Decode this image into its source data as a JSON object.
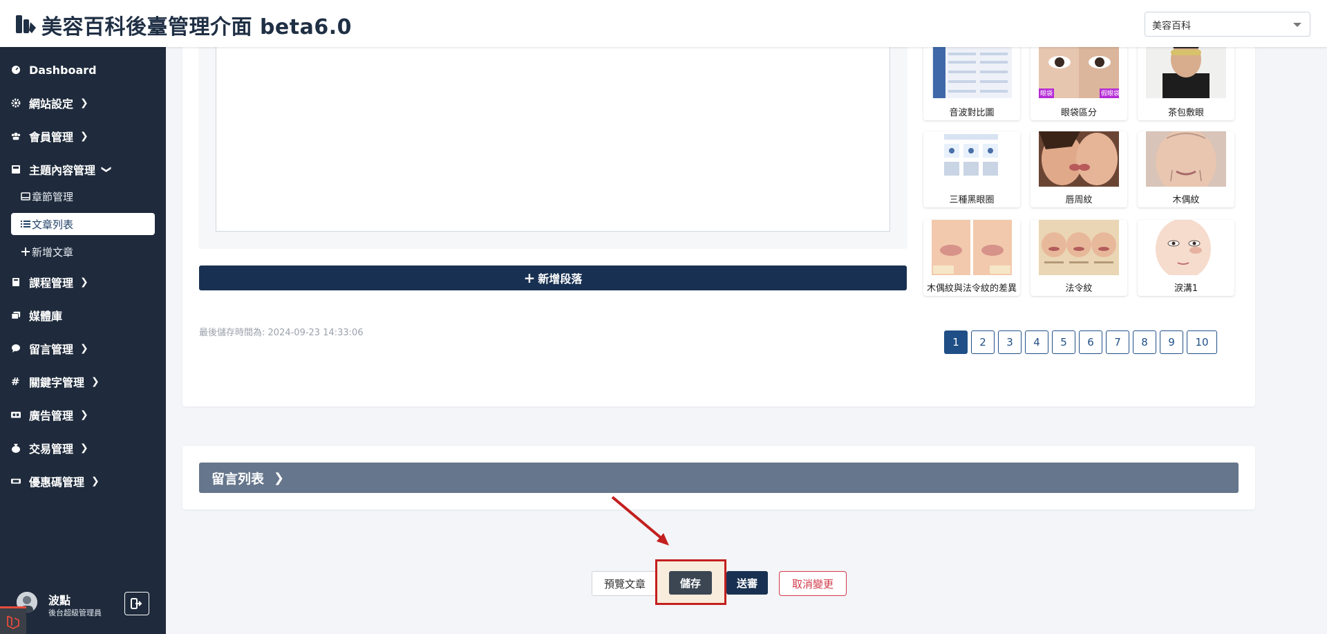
{
  "header": {
    "title": "美容百科後臺管理介面 beta6.0",
    "site_select_value": "美容百科"
  },
  "sidebar": {
    "items": [
      {
        "label": "Dashboard",
        "icon": "dashboard-icon",
        "has_chevron": false
      },
      {
        "label": "網站設定",
        "icon": "gear-icon",
        "has_chevron": true
      },
      {
        "label": "會員管理",
        "icon": "users-icon",
        "has_chevron": true
      },
      {
        "label": "主題內容管理",
        "icon": "book-icon",
        "has_chevron": true,
        "expanded": true
      },
      {
        "label": "課程管理",
        "icon": "book-icon",
        "has_chevron": true
      },
      {
        "label": "媒體庫",
        "icon": "images-icon",
        "has_chevron": false
      },
      {
        "label": "留言管理",
        "icon": "comment-icon",
        "has_chevron": true
      },
      {
        "label": "關鍵字管理",
        "icon": "hashtag-icon",
        "has_chevron": true
      },
      {
        "label": "廣告管理",
        "icon": "ad-icon",
        "has_chevron": true
      },
      {
        "label": "交易管理",
        "icon": "money-bag-icon",
        "has_chevron": true
      },
      {
        "label": "優惠碼管理",
        "icon": "ticket-icon",
        "has_chevron": true
      }
    ],
    "sub_items": [
      {
        "label": "章節管理",
        "icon": "card-icon",
        "active": false
      },
      {
        "label": "文章列表",
        "icon": "list-icon",
        "active": true
      },
      {
        "label": "新增文章",
        "icon": "plus-icon",
        "active": false
      }
    ],
    "user": {
      "name": "波點",
      "role": "後台超級管理員"
    }
  },
  "editor": {
    "add_paragraph_label": "新增段落",
    "last_saved_label": "最後儲存時間為:",
    "last_saved_time": "2024-09-23 14:33:06"
  },
  "media": {
    "items": [
      {
        "label": "音波對比圖"
      },
      {
        "label": "眼袋區分",
        "tag_left": "眼袋",
        "tag_right": "假眼袋"
      },
      {
        "label": "茶包敷眼"
      },
      {
        "label": "三種黑眼圈"
      },
      {
        "label": "唇周紋"
      },
      {
        "label": "木偶紋"
      },
      {
        "label": "木偶紋與法令紋的差異"
      },
      {
        "label": "法令紋"
      },
      {
        "label": "淚溝1"
      }
    ],
    "pages": [
      "1",
      "2",
      "3",
      "4",
      "5",
      "6",
      "7",
      "8",
      "9",
      "10"
    ],
    "current_page": "1"
  },
  "comments": {
    "title": "留言列表"
  },
  "actions": {
    "preview_label": "預覽文章",
    "save_label": "儲存",
    "submit_label": "送審",
    "cancel_label": "取消變更"
  },
  "colors": {
    "sidebar_bg": "#1f2b3c",
    "primary": "#183152",
    "highlight": "#c31f1f",
    "danger": "#d13a4a"
  }
}
